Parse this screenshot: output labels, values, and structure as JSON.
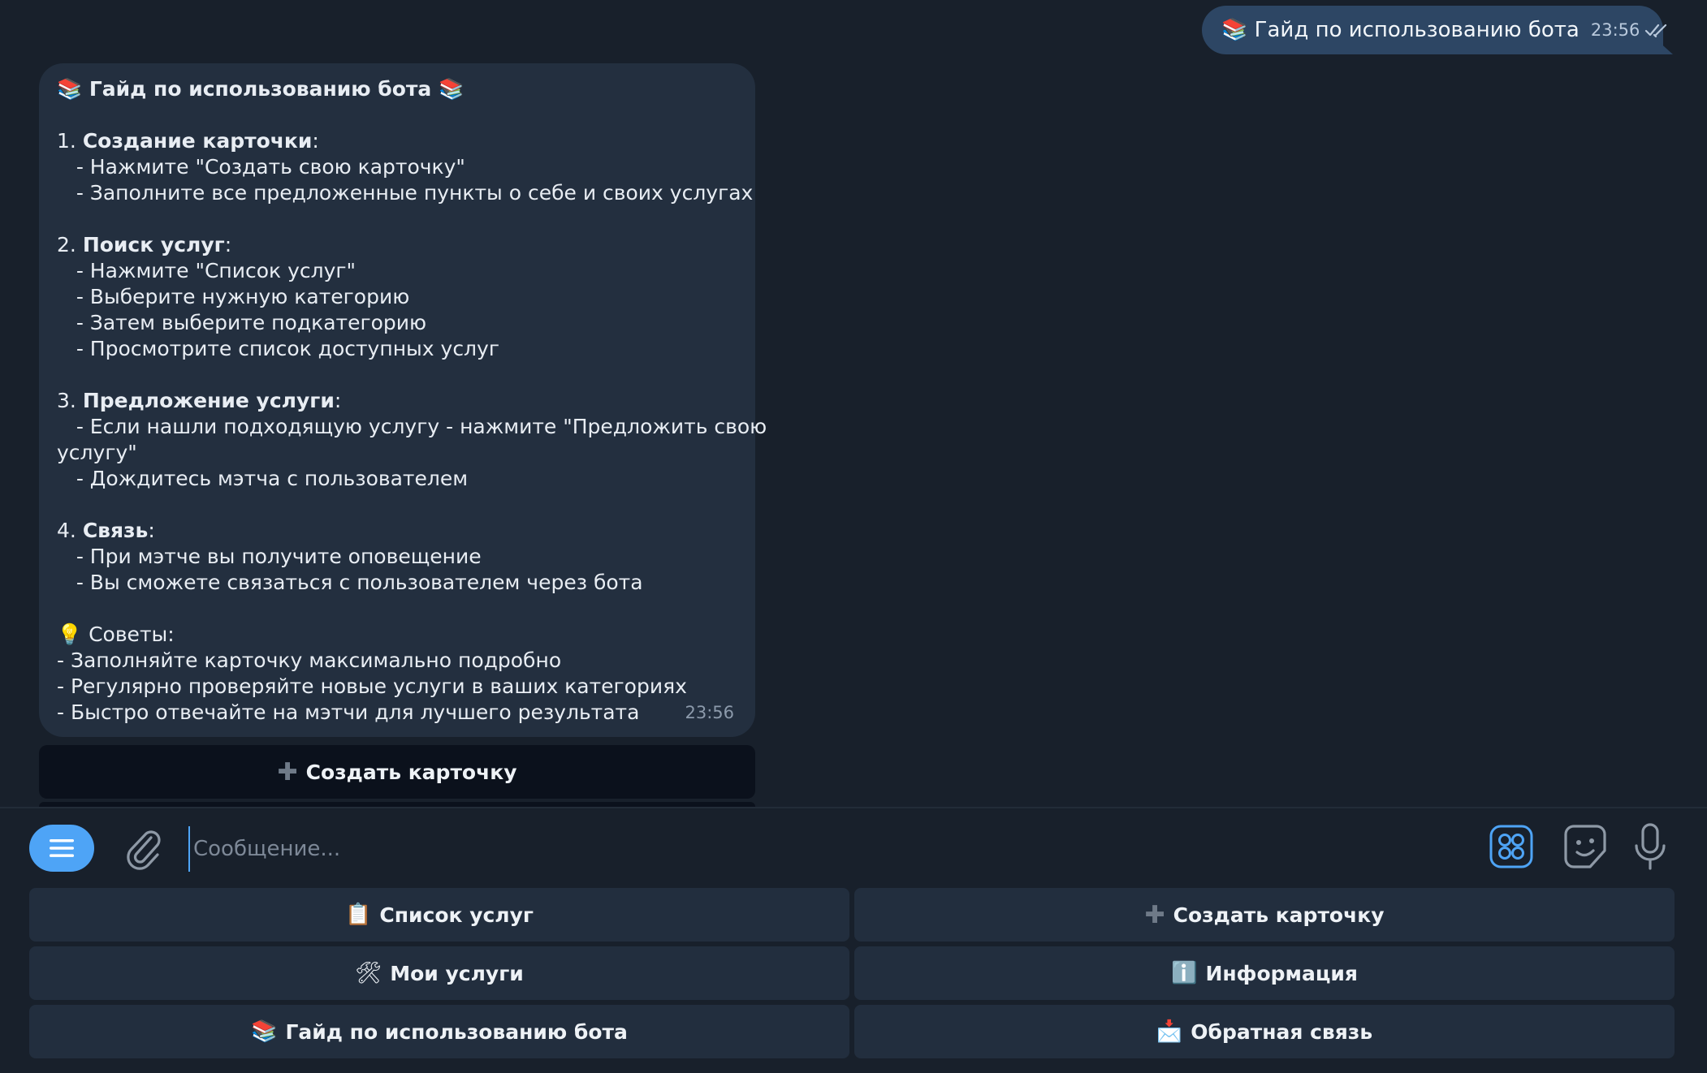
{
  "outgoing": {
    "icon": "books-icon",
    "text": "📚 Гайд по использованию бота",
    "time": "23:56",
    "status": "read-double-check"
  },
  "incoming": {
    "time": "23:56",
    "title": "📚 Гайд по использованию бота 📚",
    "s1_num": "1. ",
    "s1_title": "Создание карточки",
    "s1_colon": ":",
    "s1_l1": "   - Нажмите \"Создать свою карточку\"",
    "s1_l2": "   - Заполните все предложенные пункты о себе и своих услугах",
    "s2_num": "2. ",
    "s2_title": "Поиск услуг",
    "s2_colon": ":",
    "s2_l1": "   - Нажмите \"Список услуг\"",
    "s2_l2": "   - Выберите нужную категорию",
    "s2_l3": "   - Затем выберите подкатегорию",
    "s2_l4": "   - Просмотрите список доступных услуг",
    "s3_num": "3. ",
    "s3_title": "Предложение услуги",
    "s3_colon": ":",
    "s3_l1a": "   - Если нашли подходящую услугу - нажмите \"Предложить свою",
    "s3_l1b": "услугу\"",
    "s3_l2": "   - Дождитесь мэтча с пользователем",
    "s4_num": "4. ",
    "s4_title": "Связь",
    "s4_colon": ":",
    "s4_l1": "   - При мэтче вы получите оповещение",
    "s4_l2": "   - Вы сможете связаться с пользователем через бота",
    "tips_title": "💡 Советы:",
    "tip1": "- Заполняйте карточку максимально подробно",
    "tip2": "- Регулярно проверяйте новые услуги в ваших категориях",
    "tip3": "- Быстро отвечайте на мэтчи для лучшего результата"
  },
  "inline_button": {
    "icon": "plus-icon",
    "glyph": "✚",
    "label": "Создать карточку"
  },
  "composer": {
    "placeholder": "Сообщение...",
    "value": ""
  },
  "keyboard": {
    "buttons": [
      {
        "emoji": "📋",
        "label": "Список услуг"
      },
      {
        "emoji": "✚",
        "label": "Создать карточку"
      },
      {
        "emoji": "🛠",
        "label": "Мои услуги"
      },
      {
        "emoji": "ℹ️",
        "label": "Информация"
      },
      {
        "emoji": "📚",
        "label": "Гайд по использованию бота"
      },
      {
        "emoji": "📩",
        "label": "Обратная связь"
      }
    ]
  },
  "colors": {
    "background": "#18202b",
    "outgoing_bubble": "#2d4664",
    "incoming_bubble": "#232f3f",
    "accent": "#4ea4f6",
    "keyboard_button": "#222e3e"
  }
}
